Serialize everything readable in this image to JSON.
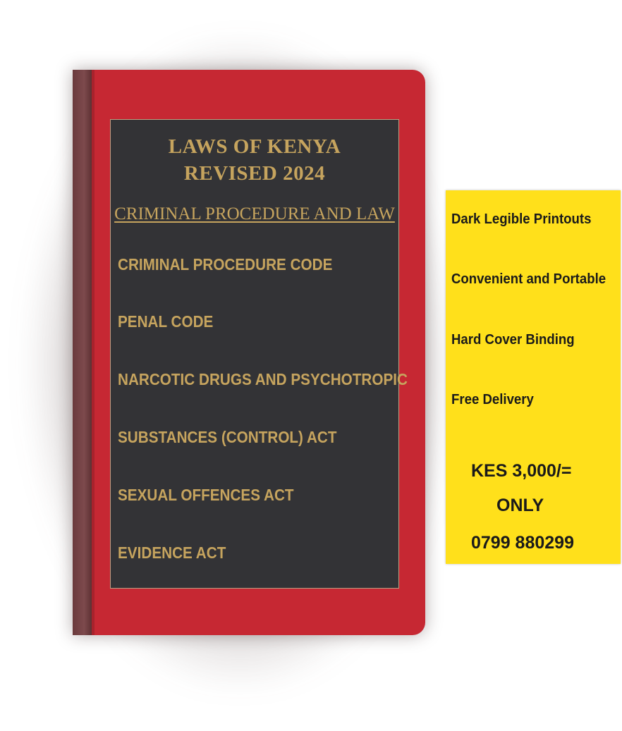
{
  "cover": {
    "title_line1": "LAWS OF KENYA",
    "title_line2": "REVISED 2024",
    "subtitle": "CRIMINAL PROCEDURE AND LAW",
    "items": [
      "CRIMINAL PROCEDURE CODE",
      "PENAL CODE",
      "NARCOTIC DRUGS AND PSYCHOTROPIC",
      "SUBSTANCES (CONTROL) ACT",
      "SEXUAL OFFENCES ACT",
      "EVIDENCE ACT"
    ]
  },
  "sticker": {
    "features": [
      "Dark Legible Printouts",
      "Convenient and Portable",
      "Hard Cover Binding",
      "Free Delivery"
    ],
    "price": "KES 3,000/=",
    "price_note": "ONLY",
    "phone": "0799 880299"
  },
  "colors": {
    "cover_red": "#c62833",
    "panel_dark": "#333336",
    "gold_text": "#c6a45e",
    "sticker_yellow": "#ffe01b"
  }
}
